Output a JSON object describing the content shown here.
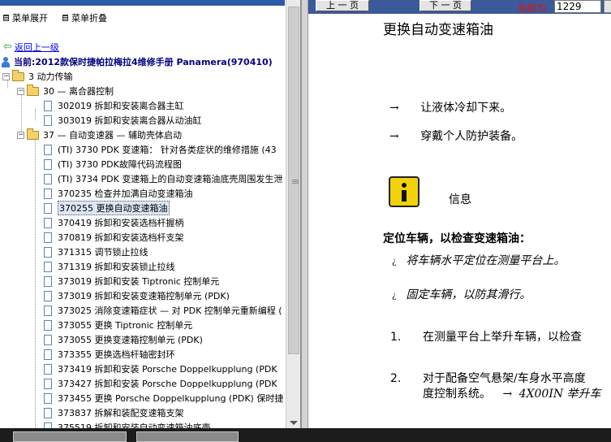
{
  "left_panel": {
    "toolbar": {
      "expand_label": "菜单展开",
      "collapse_label": "菜单折叠"
    },
    "back_label": "返回上一级",
    "current_label": "当前:2012款保时捷帕拉梅拉4维修手册 Panamera(970410)",
    "tree": {
      "root": "3 动力传输",
      "group30": "30 — 离合器控制",
      "group30_items": [
        "302019 拆卸和安装离合器主缸",
        "303019 拆卸和安装离合器从动油缸"
      ],
      "group37": "37 — 自动变速器 — 辅助壳体启动",
      "group37_items": [
        "(TI) 3730 PDK 变速箱： 针对各类症状的维修措施 (43",
        "(TI) 3730 PDK故障代码流程图",
        "(TI) 3734 PDK 变速箱上的自动变速箱油底壳周围发生泄",
        "370235 检查并加满自动变速箱油",
        "370255 更换自动变速箱油",
        "370419 拆卸和安装选档杆握柄",
        "370819 拆卸和安装选档杆支架",
        "371315 调节锁止拉线",
        "371319 拆卸和安装锁止拉线",
        "373019 拆卸和安装 Tiptronic 控制单元",
        "373019 拆卸和安装变速箱控制单元 (PDK)",
        "373025 消除变速箱症状 — 对 PDK 控制单元重新编程 (",
        "373055 更换 Tiptronic 控制单元",
        "373055 更换变速箱控制单元 (PDK)",
        "373355 更换选档杆轴密封环",
        "373419 拆卸和安装 Porsche Doppelkupplung (PDK",
        "373427 拆卸和安装 Porsche Doppelkupplung (PDK",
        "373455 更换 Porsche Doppelkupplung (PDK) 保时捷",
        "373837 拆解和装配变速箱支架",
        "375519 拆卸和安装自动变速箱油底壳"
      ],
      "selected_index": 4
    }
  },
  "right_panel": {
    "nav": {
      "prev_label": "上 一 页",
      "next_label": "下 一 页",
      "current_label": "当前为",
      "page_value": "1229"
    },
    "title": "更换自动变速箱油",
    "steps": [
      {
        "arrow": "→",
        "text": "让液体冷却下来。"
      },
      {
        "arrow": "→",
        "text": "穿戴个人防护装备。"
      }
    ],
    "info_label": "信息",
    "section_heading": "定位车辆，以检查变速箱油：",
    "bullets": [
      {
        "mark": "¿",
        "text": "将车辆水平定位在测量平台上。"
      },
      {
        "mark": "¿",
        "text": "固定车辆，以防其滑行。"
      }
    ],
    "numbered": [
      {
        "n": "1.",
        "text": "在测量平台上举升车辆，以检查"
      },
      {
        "n": "2.",
        "text": "对于配备空气悬架/车身水平高度"
      }
    ],
    "numbered_cont": {
      "text": "度控制系统。",
      "arrow": "→",
      "ref": "4X00IN 举升车"
    }
  },
  "colors": {
    "accent": "#3c5a99",
    "link": "#0000ee",
    "current": "#000080",
    "page_label": "#e01010"
  },
  "icons": [
    "menu-expand-icon",
    "menu-collapse-icon",
    "back-arrow-icon",
    "person-icon",
    "folder-icon",
    "document-icon",
    "info-icon"
  ]
}
